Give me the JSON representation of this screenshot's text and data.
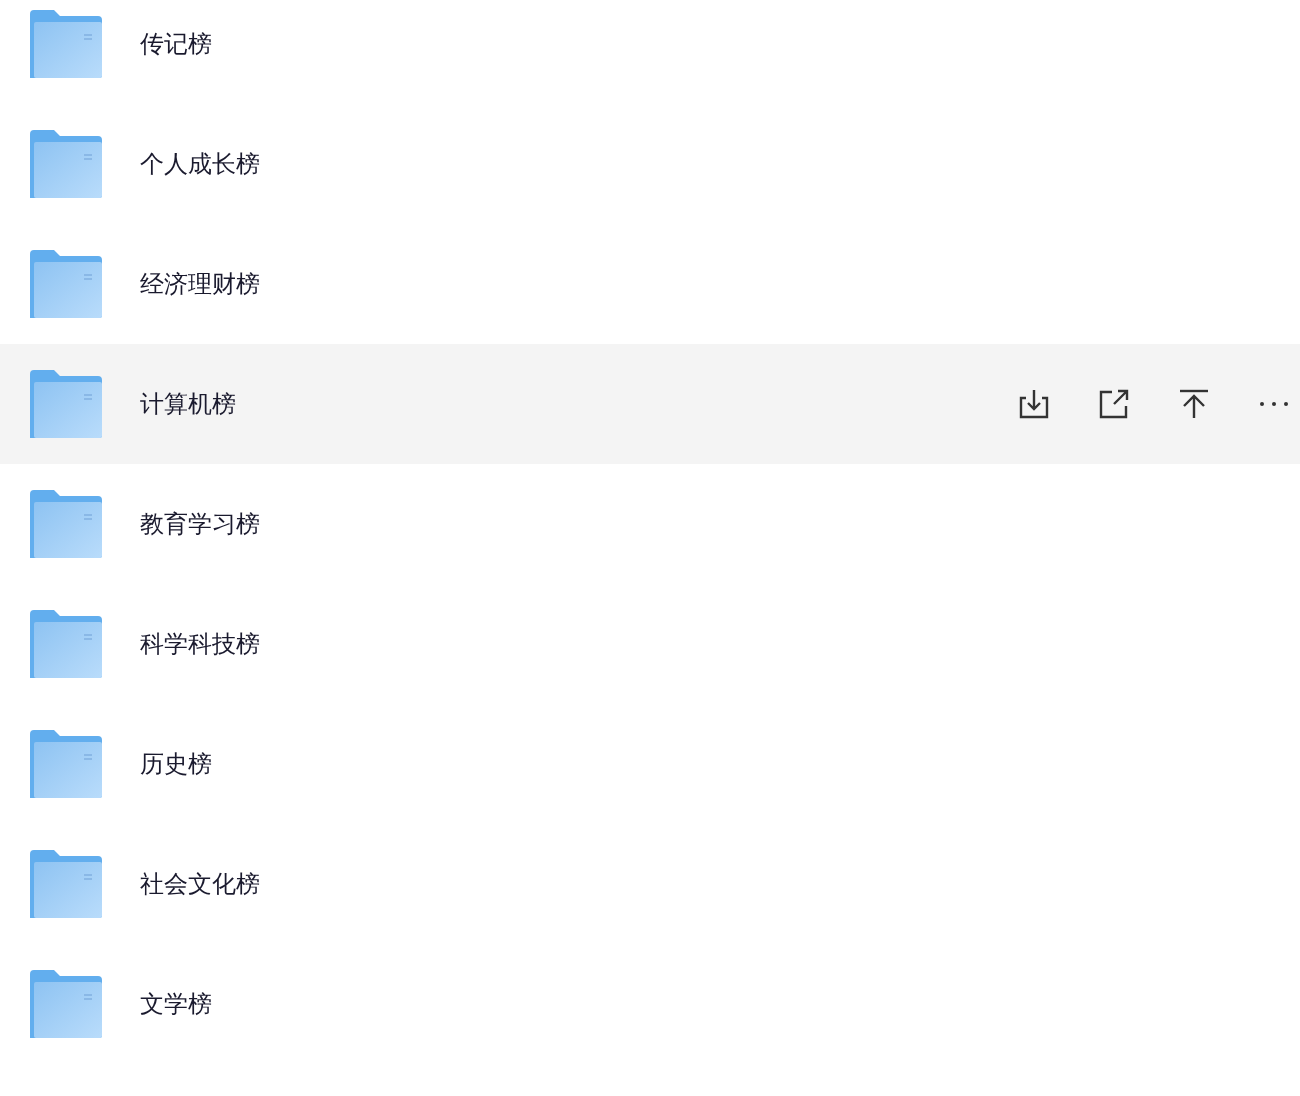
{
  "folders": [
    {
      "name": "传记榜",
      "highlighted": false
    },
    {
      "name": "个人成长榜",
      "highlighted": false
    },
    {
      "name": "经济理财榜",
      "highlighted": false
    },
    {
      "name": "计算机榜",
      "highlighted": true
    },
    {
      "name": "教育学习榜",
      "highlighted": false
    },
    {
      "name": "科学科技榜",
      "highlighted": false
    },
    {
      "name": "历史榜",
      "highlighted": false
    },
    {
      "name": "社会文化榜",
      "highlighted": false
    },
    {
      "name": "文学榜",
      "highlighted": false
    }
  ]
}
